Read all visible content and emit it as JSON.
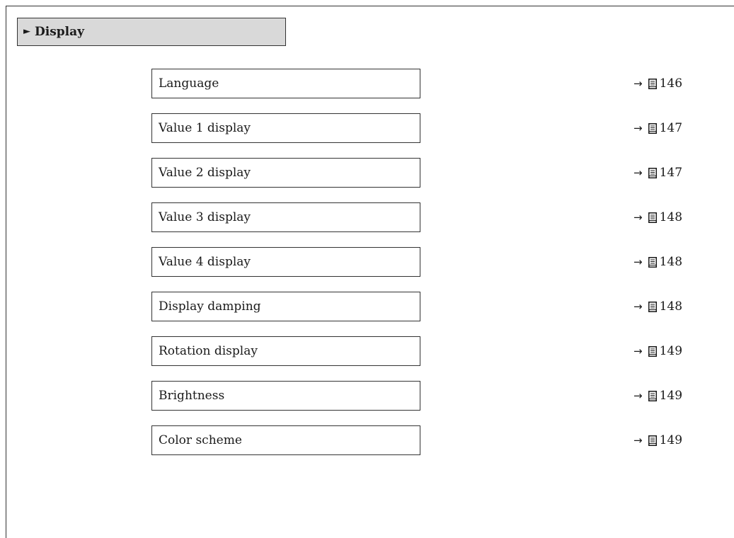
{
  "menu": {
    "title_marker": "►",
    "title": "Display"
  },
  "items": [
    {
      "label": "Language",
      "ref_arrow": "→",
      "ref_page": "146"
    },
    {
      "label": "Value 1 display",
      "ref_arrow": "→",
      "ref_page": "147"
    },
    {
      "label": "Value 2 display",
      "ref_arrow": "→",
      "ref_page": "147"
    },
    {
      "label": "Value 3 display",
      "ref_arrow": "→",
      "ref_page": "148"
    },
    {
      "label": "Value 4 display",
      "ref_arrow": "→",
      "ref_page": "148"
    },
    {
      "label": "Display damping",
      "ref_arrow": "→",
      "ref_page": "148"
    },
    {
      "label": "Rotation display",
      "ref_arrow": "→",
      "ref_page": "149"
    },
    {
      "label": "Brightness",
      "ref_arrow": "→",
      "ref_page": "149"
    },
    {
      "label": "Color scheme",
      "ref_arrow": "→",
      "ref_page": "149"
    }
  ],
  "icons": {
    "page_reference": "book-icon"
  }
}
